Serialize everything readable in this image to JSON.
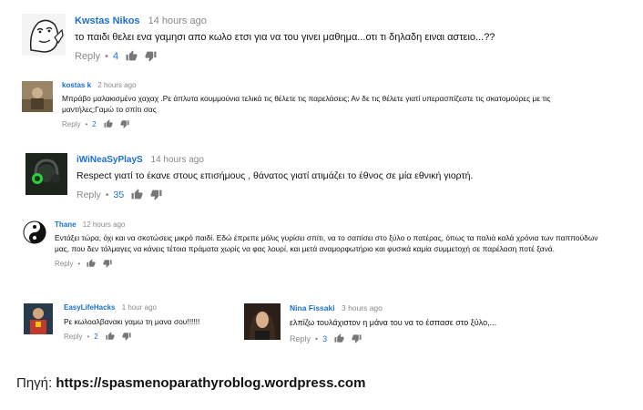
{
  "comments": [
    {
      "author": "Kwstas Nikos",
      "time": "14 hours ago",
      "text": "το παιδι θελει ενα γαμησι απο κωλο ετσι για να του γινει μαθημα...οτι τι δηλαδη ειναι αστειο...??",
      "reply_label": "Reply",
      "likes": "4",
      "avatar": "meme-face-icon"
    },
    {
      "author": "kostas k",
      "time": "2 hours ago",
      "text": "Μπράβο μαλακισμένο χαχαχ .Ρε άπλυτα κουμμούνια τελικά τις θέλετε τις παρελάσεις; Αν δε τις θέλετε γιατί υπερασπίζεστε τις σκατομούρες με τις μαντήλες;Γαμώ το σπίτι σας",
      "reply_label": "Reply",
      "likes": "2",
      "avatar": "photo-avatar"
    },
    {
      "author": "iWiNeaSyPlayS",
      "time": "14 hours ago",
      "text": "Respect γιατί το έκανε στους επισήμους , θάνατος γιατί ατιμάζει το έθνος σε μία εθνική γιορτή.",
      "reply_label": "Reply",
      "likes": "35",
      "avatar": "headset-avatar"
    },
    {
      "author": "Thane",
      "time": "12 hours ago",
      "text": "Εντάξει τώρα, όχι και να σκοτώσεις μικρό παιδί. Εδώ έπρεπε μόλις γυρίσει σπίτι, να το σαπίσει στο ξύλο ο πατέρας, όπως τα παλιά καλά χρόνια των παππούδων μας, που δεν τόλμαγες να κάνεις τέτοια πράματα χωρίς να φας λουρί, και μετά αναμορφωτήριο και φυσικά καμία συμμετοχή σε παρέλαση ποτέ ξανά.",
      "reply_label": "Reply",
      "likes": "",
      "avatar": "yin-yang-icon"
    },
    {
      "author": "EasyLifeHacks",
      "time": "1 hour ago",
      "text": "Ρε κωλοαλβανακι γαμω τη μανα σου!!!!!!",
      "reply_label": "Reply",
      "likes": "2",
      "avatar": "photo-avatar"
    },
    {
      "author": "Nina Fissaki",
      "time": "3 hours ago",
      "text": "ελπίζω τουλάχιστον η μάνα του να το έσπασε στο ξύλο,...",
      "reply_label": "Reply",
      "likes": "3",
      "avatar": "photo-avatar"
    }
  ],
  "source": {
    "label": "Πηγή: ",
    "url": "https://spasmenoparathyroblog.wordpress.com"
  },
  "colors": {
    "author": "#1a6fd1",
    "count": "#1a6fd1",
    "muted": "#8a8a8a"
  }
}
